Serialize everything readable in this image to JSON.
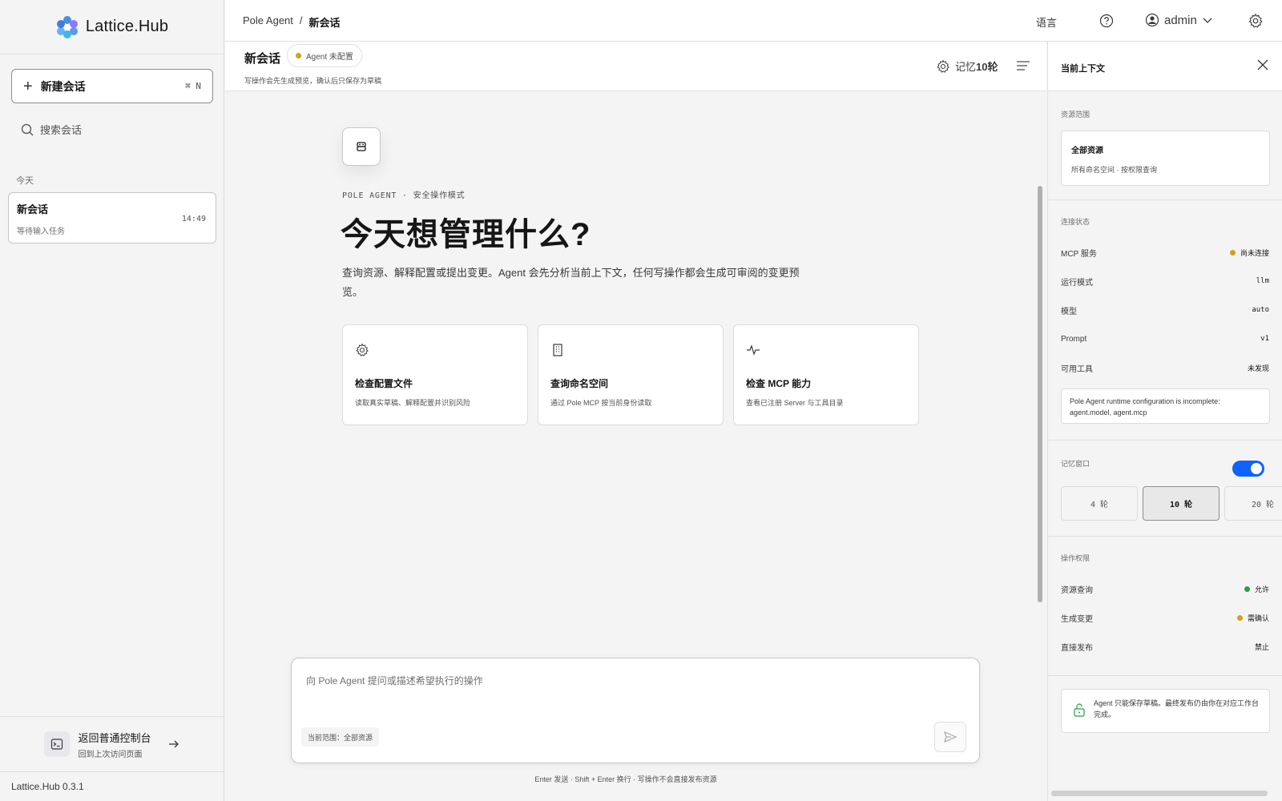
{
  "brand": {
    "name": "Lattice.Hub",
    "version": "Lattice.Hub 0.3.1"
  },
  "sidebar": {
    "new_chat_label": "新建会话",
    "new_chat_shortcut": "⌘ N",
    "search_placeholder": "搜索会话",
    "section_today": "今天",
    "chats": [
      {
        "title": "新会话",
        "subtitle": "等待输入任务",
        "time": "14:49"
      }
    ],
    "back_console": {
      "title": "返回普通控制台",
      "subtitle": "回到上次访问页面"
    }
  },
  "topbar": {
    "breadcrumb": [
      "Pole Agent",
      "/",
      "新会话"
    ],
    "language": "语言",
    "user": "admin"
  },
  "chat_header": {
    "title": "新会话",
    "agent_status": "Agent 未配置",
    "hint": "写操作会先生成预览，确认后只保存为草稿",
    "memory_label": "记忆",
    "memory_value": "10轮"
  },
  "main": {
    "eyebrow": "POLE AGENT · 安全操作模式",
    "headline": "今天想管理什么?",
    "lead": "查询资源、解释配置或提出变更。Agent 会先分析当前上下文，任何写操作都会生成可审阅的变更预览。",
    "cards": [
      {
        "icon": "gear-icon",
        "title": "检查配置文件",
        "subtitle": "读取真实草稿、解释配置并识别风险"
      },
      {
        "icon": "building-icon",
        "title": "查询命名空间",
        "subtitle": "通过 Pole MCP 按当前身份读取"
      },
      {
        "icon": "activity-icon",
        "title": "检查 MCP 能力",
        "subtitle": "查看已注册 Server 与工具目录"
      }
    ],
    "composer_placeholder": "向 Pole Agent 提问或描述希望执行的操作",
    "composer_scope": "当前范围：全部资源",
    "footer_hint": "Enter 发送 · Shift + Enter 换行 · 写操作不会直接发布资源"
  },
  "right_panel": {
    "title": "当前上下文",
    "scope_section": "资源范围",
    "scope_title": "全部资源",
    "scope_desc": "所有命名空间 · 按权限查询",
    "conn_section": "连接状态",
    "conn_rows": [
      {
        "key": "MCP 服务",
        "value": "尚未连接",
        "dot": "#d4a017"
      },
      {
        "key": "运行模式",
        "value": "llm"
      },
      {
        "key": "模型",
        "value": "auto"
      },
      {
        "key": "Prompt",
        "value": "v1"
      },
      {
        "key": "可用工具",
        "value": "未发现"
      }
    ],
    "warning": "Pole Agent runtime configuration is incomplete: agent.model, agent.mcp",
    "memory_section": "记忆窗口",
    "memory_enabled": true,
    "memory_options": [
      "4 轮",
      "10 轮",
      "20 轮"
    ],
    "memory_selected": "10 轮",
    "perm_section": "操作权限",
    "perm_rows": [
      {
        "key": "资源查询",
        "value": "允许",
        "dot": "#24a148"
      },
      {
        "key": "生成变更",
        "value": "需确认",
        "dot": "#d4a017"
      },
      {
        "key": "直接发布",
        "value": "禁止"
      }
    ],
    "lock_note": "Agent 只能保存草稿。最终发布仍由你在对应工作台完成。"
  },
  "colors": {
    "accent": "#0f62fe",
    "warn": "#d4a017",
    "ok": "#24a148"
  }
}
